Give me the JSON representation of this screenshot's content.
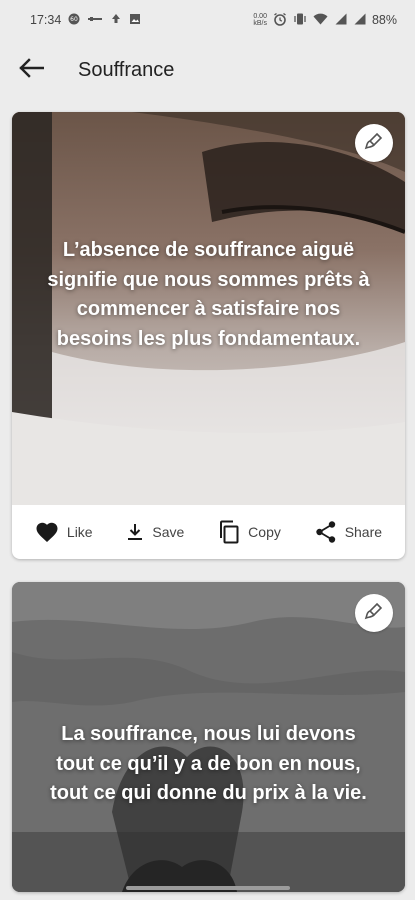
{
  "status_bar": {
    "time": "17:34",
    "battery": "88%",
    "net_speed_top": "0.00",
    "net_speed_bottom": "kB/s"
  },
  "app_bar": {
    "title": "Souffrance",
    "back_icon": "arrow-back-icon"
  },
  "cards": [
    {
      "quote": "L’absence de souffrance aiguë signifie que nous sommes prêts à commencer à satisfaire nos besoins les plus fondamentaux.",
      "edit_icon": "brush-icon"
    },
    {
      "quote": "La souffrance, nous lui devons tout ce qu’il y a de bon en nous, tout ce qui donne du prix à la vie.",
      "edit_icon": "brush-icon"
    }
  ],
  "actions": {
    "like": "Like",
    "save": "Save",
    "copy": "Copy",
    "share": "Share"
  }
}
